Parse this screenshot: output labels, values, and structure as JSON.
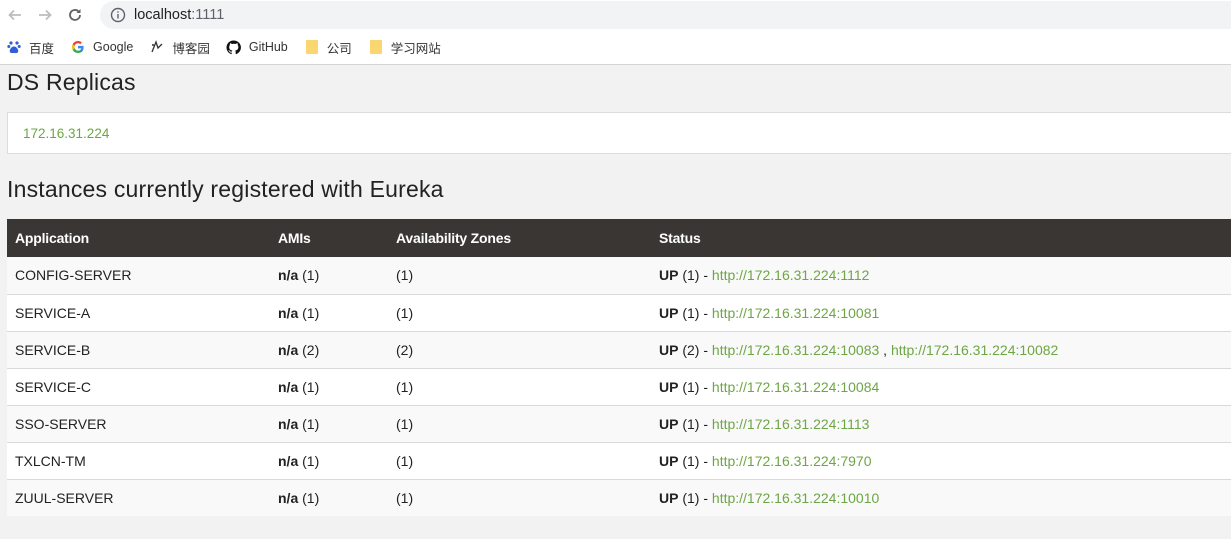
{
  "browser": {
    "url_host": "localhost",
    "url_port": ":1111",
    "bookmarks": [
      {
        "label": "百度",
        "icon": "baidu-icon"
      },
      {
        "label": "Google",
        "icon": "google-icon"
      },
      {
        "label": "博客园",
        "icon": "cnblogs-icon"
      },
      {
        "label": "GitHub",
        "icon": "github-icon"
      },
      {
        "label": "公司",
        "icon": "folder-icon"
      },
      {
        "label": "学习网站",
        "icon": "folder-icon"
      }
    ]
  },
  "replicas": {
    "title": "DS Replicas",
    "items": [
      "172.16.31.224"
    ]
  },
  "instances": {
    "title": "Instances currently registered with Eureka",
    "headers": [
      "Application",
      "AMIs",
      "Availability Zones",
      "Status"
    ],
    "rows": [
      {
        "app": "CONFIG-SERVER",
        "ami": "n/a",
        "ami_count": " (1)",
        "zones": "(1)",
        "status": "UP",
        "status_count": " (1) - ",
        "links": [
          "http://172.16.31.224:1112"
        ]
      },
      {
        "app": "SERVICE-A",
        "ami": "n/a",
        "ami_count": " (1)",
        "zones": "(1)",
        "status": "UP",
        "status_count": " (1) - ",
        "links": [
          "http://172.16.31.224:10081"
        ]
      },
      {
        "app": "SERVICE-B",
        "ami": "n/a",
        "ami_count": " (2)",
        "zones": "(2)",
        "status": "UP",
        "status_count": " (2) - ",
        "links": [
          "http://172.16.31.224:10083",
          "http://172.16.31.224:10082"
        ]
      },
      {
        "app": "SERVICE-C",
        "ami": "n/a",
        "ami_count": " (1)",
        "zones": "(1)",
        "status": "UP",
        "status_count": " (1) - ",
        "links": [
          "http://172.16.31.224:10084"
        ]
      },
      {
        "app": "SSO-SERVER",
        "ami": "n/a",
        "ami_count": " (1)",
        "zones": "(1)",
        "status": "UP",
        "status_count": " (1) - ",
        "links": [
          "http://172.16.31.224:1113"
        ]
      },
      {
        "app": "TXLCN-TM",
        "ami": "n/a",
        "ami_count": " (1)",
        "zones": "(1)",
        "status": "UP",
        "status_count": " (1) - ",
        "links": [
          "http://172.16.31.224:7970"
        ]
      },
      {
        "app": "ZUUL-SERVER",
        "ami": "n/a",
        "ami_count": " (1)",
        "zones": "(1)",
        "status": "UP",
        "status_count": " (1) - ",
        "links": [
          "http://172.16.31.224:10010"
        ]
      }
    ]
  },
  "colors": {
    "link": "#6da644",
    "header_bg": "#3a3633"
  }
}
